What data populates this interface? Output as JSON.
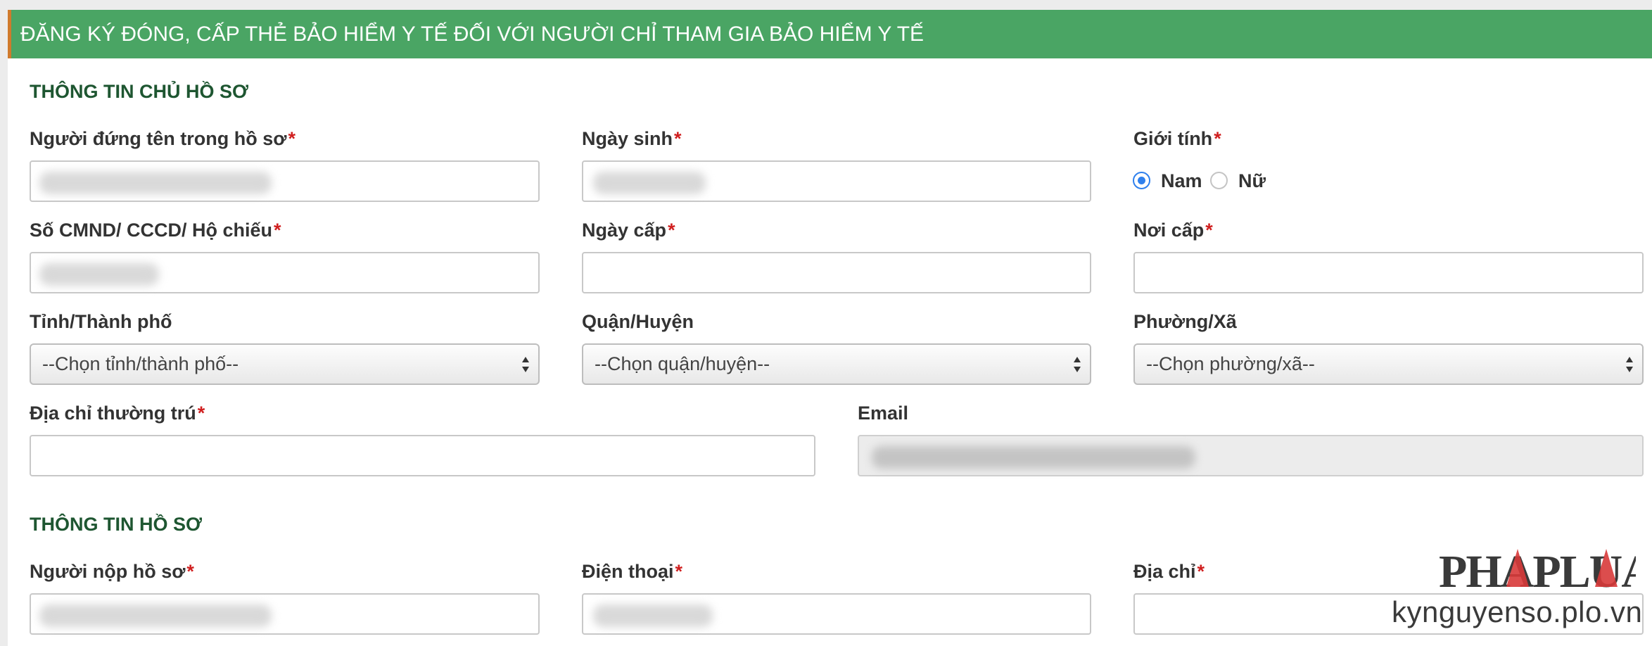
{
  "header": {
    "title": "ĐĂNG KÝ ĐÓNG, CẤP THẺ BẢO HIỂM Y TẾ ĐỐI VỚI NGƯỜI CHỈ THAM GIA BẢO HIỂM Y TẾ"
  },
  "sections": {
    "owner_info": "THÔNG TIN CHỦ HỒ SƠ",
    "file_info": "THÔNG TIN HỒ SƠ"
  },
  "required_mark": "*",
  "owner": {
    "full_name_label": "Người đứng tên trong hồ sơ",
    "dob_label": "Ngày sinh",
    "gender_label": "Giới tính",
    "gender_options": {
      "male": "Nam",
      "female": "Nữ"
    },
    "gender_selected": "Nam",
    "id_label": "Số CMND/ CCCD/ Hộ chiếu",
    "issue_date_label": "Ngày cấp",
    "issue_place_label": "Nơi cấp",
    "province_label": "Tỉnh/Thành phố",
    "province_placeholder": "--Chọn tỉnh/thành phố--",
    "district_label": "Quận/Huyện",
    "district_placeholder": "--Chọn quận/huyện--",
    "ward_label": "Phường/Xã",
    "ward_placeholder": "--Chọn phường/xã--",
    "address_label": "Địa chỉ thường trú",
    "email_label": "Email"
  },
  "submitter": {
    "name_label": "Người nộp hồ sơ",
    "phone_label": "Điện thoại",
    "address_label": "Địa chỉ"
  },
  "watermark": {
    "logo_text": "PHAPLUAT",
    "url": "kynguyenso.plo.vn"
  },
  "colors": {
    "header_bg": "#4aa564",
    "section_title": "#1e5631",
    "required": "#d01f1f",
    "radio_checked": "#2f80ed"
  }
}
